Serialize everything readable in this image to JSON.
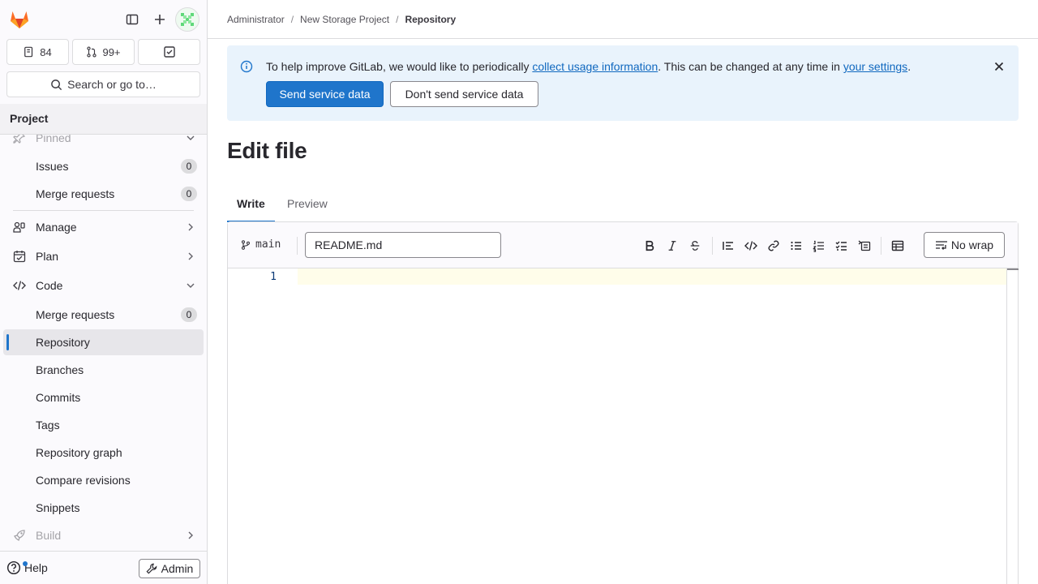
{
  "sidebar": {
    "counts": {
      "issues": "84",
      "merge_requests": "99+"
    },
    "search_label": "Search or go to…",
    "section_title": "Project",
    "items": [
      {
        "label": "Pinned"
      },
      {
        "label": "Issues",
        "badge": "0"
      },
      {
        "label": "Merge requests",
        "badge": "0"
      },
      {
        "label": "Manage"
      },
      {
        "label": "Plan"
      },
      {
        "label": "Code"
      },
      {
        "label": "Merge requests",
        "badge": "0"
      },
      {
        "label": "Repository"
      },
      {
        "label": "Branches"
      },
      {
        "label": "Commits"
      },
      {
        "label": "Tags"
      },
      {
        "label": "Repository graph"
      },
      {
        "label": "Compare revisions"
      },
      {
        "label": "Snippets"
      },
      {
        "label": "Build"
      }
    ],
    "footer": {
      "help_label": "Help",
      "admin_label": "Admin"
    }
  },
  "breadcrumb": {
    "items": [
      "Administrator",
      "New Storage Project",
      "Repository"
    ],
    "separator": "/"
  },
  "alert": {
    "text_before": "To help improve GitLab, we would like to periodically ",
    "link1": "collect usage information",
    "text_middle": ". This can be changed at any time in ",
    "link2": "your settings",
    "text_after": ".",
    "primary_button": "Send service data",
    "secondary_button": "Don't send service data"
  },
  "page": {
    "title": "Edit file"
  },
  "tabs": [
    {
      "label": "Write"
    },
    {
      "label": "Preview"
    }
  ],
  "editor": {
    "branch": "main",
    "file_name": "README.md",
    "no_wrap_label": "No wrap",
    "line_numbers": [
      "1"
    ]
  },
  "colors": {
    "primary": "#1f75cb",
    "alert_bg": "#e9f3fc",
    "current_line": "#fffdea"
  }
}
